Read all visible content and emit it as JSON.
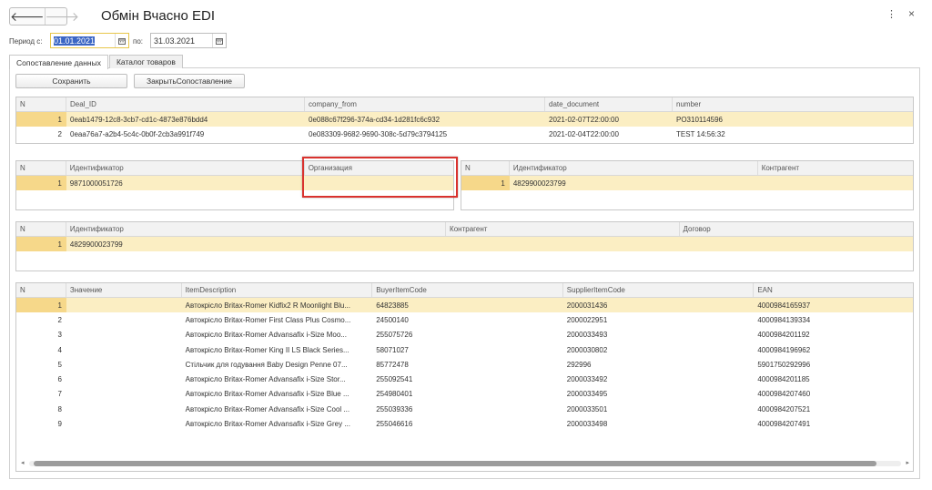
{
  "window": {
    "title": "Обмін Вчасно EDI",
    "more_icon": "⋮",
    "close_icon": "×"
  },
  "nav": {
    "back": "🡐",
    "forward": "🡒"
  },
  "period": {
    "from_label": "Период с:",
    "from_value": "01.01.2021",
    "to_label": "по:",
    "to_value": "31.03.2021"
  },
  "tabs": [
    {
      "label": "Сопоставление данных"
    },
    {
      "label": "Каталог товаров"
    }
  ],
  "toolbar": {
    "save_label": "Сохранить",
    "close_label": "ЗакрытьСопоставление"
  },
  "deals": {
    "headers": [
      "N",
      "Deal_ID",
      "company_from",
      "date_document",
      "number"
    ],
    "rows": [
      [
        "1",
        "0eab1479-12c8-3cb7-cd1c-4873e876bdd4",
        "0e088c67f296-374a-cd34-1d281fc6c932",
        "2021-02-07T22:00:00",
        "PO310114596"
      ],
      [
        "2",
        "0eaa76a7-a2b4-5c4c-0b0f-2cb3a991f749",
        "0e083309-9682-9690-308c-5d79c3794125",
        "2021-02-04T22:00:00",
        "TEST 14:56:32"
      ]
    ]
  },
  "org_left": {
    "headers": [
      "N",
      "Идентификатор",
      "Организация"
    ],
    "rows": [
      [
        "1",
        "9871000051726",
        ""
      ]
    ]
  },
  "org_right": {
    "headers": [
      "N",
      "Идентификатор",
      "Контрагент"
    ],
    "rows": [
      [
        "1",
        "4829900023799",
        ""
      ]
    ]
  },
  "contracts": {
    "headers": [
      "N",
      "Идентификатор",
      "Контрагент",
      "Договор"
    ],
    "rows": [
      [
        "1",
        "4829900023799",
        "",
        ""
      ]
    ]
  },
  "items": {
    "headers": [
      "N",
      "Значение",
      "ItemDescription",
      "BuyerItemCode",
      "SupplierItemCode",
      "EAN"
    ],
    "rows": [
      [
        "1",
        "",
        "Автокрісло Britax-Romer Kidfix2 R Moonlight Blu...",
        "64823885",
        "2000031436",
        "4000984165937"
      ],
      [
        "2",
        "",
        "Автокрісло Britax-Romer First Class Plus Cosmo...",
        "24500140",
        "2000022951",
        "4000984139334"
      ],
      [
        "3",
        "",
        "Автокрісло Britax-Romer Advansafix i-Size Moo...",
        "255075726",
        "2000033493",
        "4000984201192"
      ],
      [
        "4",
        "",
        "Автокрісло Britax-Romer King II LS Black Series...",
        "58071027",
        "2000030802",
        "4000984196962"
      ],
      [
        "5",
        "",
        "Стільчик для годування Baby Design Penne 07...",
        "85772478",
        "292996",
        "5901750292996"
      ],
      [
        "6",
        "",
        "Автокрісло Britax-Romer Advansafix i-Size Stor...",
        "255092541",
        "2000033492",
        "4000984201185"
      ],
      [
        "7",
        "",
        "Автокрісло Britax-Romer Advansafix i-Size Blue ...",
        "254980401",
        "2000033495",
        "4000984207460"
      ],
      [
        "8",
        "",
        "Автокрісло Britax-Romer Advansafix i-Size Cool ...",
        "255039336",
        "2000033501",
        "4000984207521"
      ],
      [
        "9",
        "",
        "Автокрісло Britax-Romer Advansafix i-Size Grey ...",
        "255046616",
        "2000033498",
        "4000984207491"
      ]
    ]
  },
  "scroll": {
    "left": "◂",
    "right": "▸"
  },
  "colors": {
    "selected_row": "#fbeec3",
    "selected_num": "#f6d88a",
    "highlight_box": "#d9322e",
    "focus_border": "#e8c64a"
  }
}
